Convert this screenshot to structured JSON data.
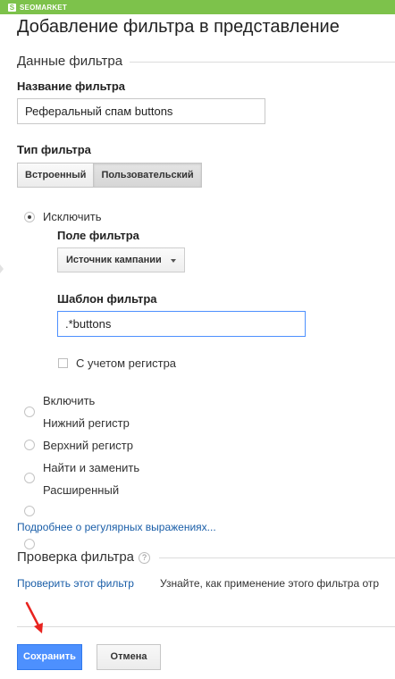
{
  "brand": {
    "name": "SEOMARKET",
    "icon": "seomarket-logo-icon"
  },
  "page": {
    "title": "Добавление фильтра в представление"
  },
  "filter_data": {
    "section_title": "Данные фильтра",
    "name_label": "Название фильтра",
    "name_value": "Реферальный спам buttons",
    "type_label": "Тип фильтра",
    "type_options": [
      {
        "label": "Встроенный",
        "selected": false
      },
      {
        "label": "Пользовательский",
        "selected": true
      }
    ]
  },
  "filter_modes": {
    "exclude": {
      "label": "Исключить",
      "checked": true
    },
    "others": [
      {
        "label": "Включить",
        "checked": false
      },
      {
        "label": "Нижний регистр",
        "checked": false
      },
      {
        "label": "Верхний регистр",
        "checked": false
      },
      {
        "label": "Найти и заменить",
        "checked": false
      },
      {
        "label": "Расширенный",
        "checked": false
      }
    ]
  },
  "exclude_settings": {
    "field_label": "Поле фильтра",
    "field_value": "Источник кампании",
    "pattern_label": "Шаблон фильтра",
    "pattern_value": ".*buttons",
    "case_sensitive_label": "С учетом регистра",
    "case_sensitive_checked": false
  },
  "regex_link": "Подробнее о регулярных выражениях...",
  "verify": {
    "section_title": "Проверка фильтра",
    "help_icon": "question-icon",
    "verify_link": "Проверить этот фильтр",
    "description": "Узнайте, как применение этого фильтра отр"
  },
  "actions": {
    "save": "Сохранить",
    "cancel": "Отмена"
  },
  "colors": {
    "topbar": "#7dc24b",
    "primary_button": "#4d90fe",
    "link": "#1a5ea8",
    "annotation_arrow": "#e8231f",
    "focus_border": "#4d90fe"
  },
  "annotation": {
    "icon": "red-arrow-icon"
  }
}
